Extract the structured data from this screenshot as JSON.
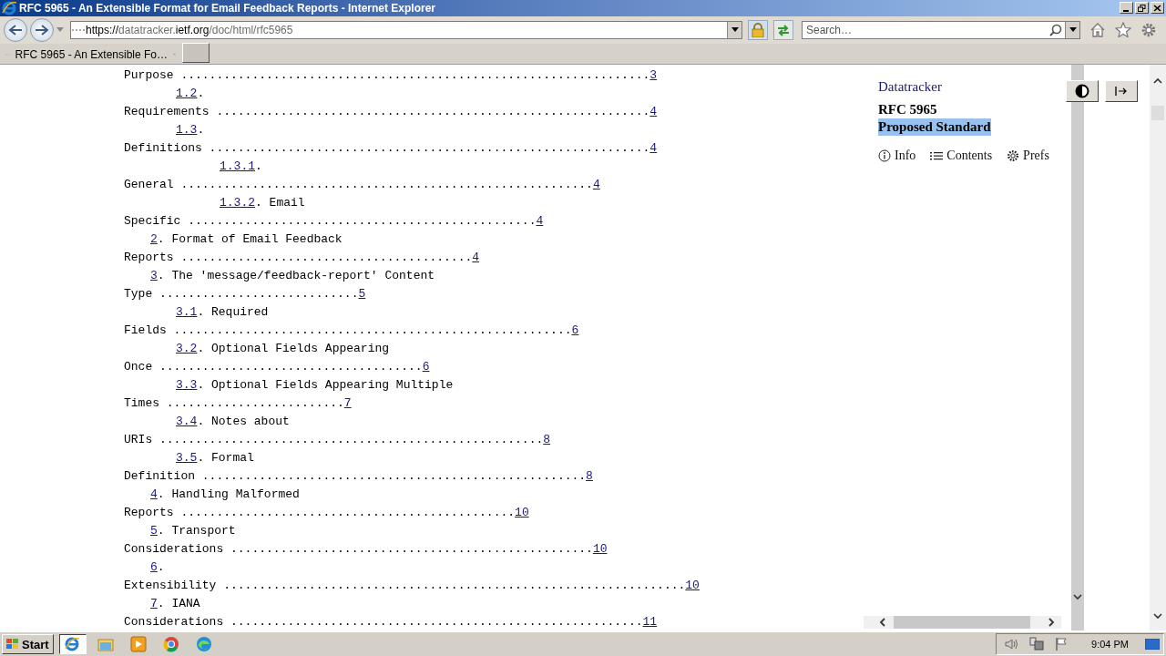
{
  "window": {
    "title": "RFC 5965 - An Extensible Format for Email Feedback Reports - Internet Explorer"
  },
  "address_bar": {
    "url_parts": [
      {
        "text": "https://",
        "strong": true
      },
      {
        "text": "datatracker.",
        "strong": false
      },
      {
        "text": "ietf.org",
        "strong": true
      },
      {
        "text": "/doc/html/rfc5965",
        "strong": false
      }
    ]
  },
  "search": {
    "placeholder": "Search…"
  },
  "tabs": [
    {
      "label": "RFC 5965 - An Extensible Fo…",
      "selected": true
    }
  ],
  "toc": [
    {
      "children": [
        {
          "entry_line": "Purpose ..................................................................",
          "page": "3"
        },
        {
          "number": "1.2",
          "heading_start": ".",
          "entry_line": "Requirements .............................................................",
          "page": "4"
        },
        {
          "number": "1.3",
          "heading_start": ".",
          "entry_line": "Definitions ..............................................................",
          "page": "4",
          "children": [
            {
              "number": "1.3.1",
              "heading_start": ".",
              "entry_line": "General ..........................................................",
              "page": "4"
            },
            {
              "number": "1.3.2",
              "heading_start": ". Email",
              "entry_line": "Specific .................................................",
              "page": "4"
            }
          ]
        }
      ]
    },
    {
      "number": "2",
      "heading_start": ". Format of Email Feedback",
      "entry_line": "Reports .........................................",
      "page": "4"
    },
    {
      "number": "3",
      "heading_start": ". The 'message/feedback-report' Content",
      "entry_line": "Type ............................",
      "page": "5",
      "children": [
        {
          "number": "3.1",
          "heading_start": ". Required",
          "entry_line": "Fields ........................................................",
          "page": "6"
        },
        {
          "number": "3.2",
          "heading_start": ". Optional Fields Appearing",
          "entry_line": "Once .....................................",
          "page": "6"
        },
        {
          "number": "3.3",
          "heading_start": ". Optional Fields Appearing Multiple",
          "entry_line": "Times .........................",
          "page": "7"
        },
        {
          "number": "3.4",
          "heading_start": ". Notes about",
          "entry_line": "URIs ......................................................",
          "page": "8"
        },
        {
          "number": "3.5",
          "heading_start": ". Formal",
          "entry_line": "Definition ......................................................",
          "page": "8"
        }
      ]
    },
    {
      "number": "4",
      "heading_start": ". Handling Malformed",
      "entry_line": "Reports ...............................................",
      "page": "10"
    },
    {
      "number": "5",
      "heading_start": ". Transport",
      "entry_line": "Considerations ...................................................",
      "page": "10"
    },
    {
      "number": "6",
      "heading_start": ".",
      "entry_line": "Extensibility .................................................................",
      "page": "10"
    },
    {
      "number": "7",
      "heading_start": ". IANA",
      "entry_line": "Considerations ..........................................................",
      "page": "11"
    }
  ],
  "sidebar": {
    "site_link": "Datatracker",
    "doc_title": "RFC 5965",
    "status": "Proposed Standard",
    "status_highlighted": true,
    "nav": [
      {
        "label": "Info"
      },
      {
        "label": "Contents"
      },
      {
        "label": "Prefs"
      }
    ]
  },
  "taskbar": {
    "start": "Start",
    "apps": [
      {
        "kind": "ie",
        "selected": true
      },
      {
        "kind": "folder",
        "selected": false
      },
      {
        "kind": "media",
        "selected": false
      },
      {
        "kind": "chrome",
        "selected": false
      },
      {
        "kind": "edge",
        "selected": false
      }
    ],
    "clock": "9:04 PM"
  }
}
